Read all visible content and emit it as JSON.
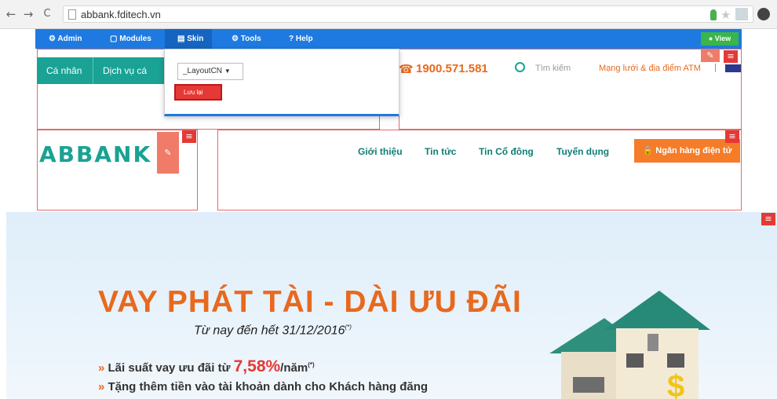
{
  "browser": {
    "back": "←",
    "forward": "→",
    "reload": "C",
    "url": "abbank.fditech.vn"
  },
  "admin_bar": {
    "items": [
      {
        "icon": "⚙",
        "label": "Admin"
      },
      {
        "icon": "▢",
        "label": "Modules"
      },
      {
        "icon": "▤",
        "label": "Skin"
      },
      {
        "icon": "⚙",
        "label": "Tools"
      },
      {
        "icon": "?",
        "label": "Help"
      }
    ],
    "view_label": "View"
  },
  "skin_popup": {
    "selected_layout": "_LayoutCN",
    "save_label": "Lưu lại"
  },
  "header": {
    "nav": [
      "Cá nhân",
      "Dịch vụ cá nhâ"
    ],
    "hotline": "1900.571.581",
    "search_placeholder": "Tìm kiếm",
    "atm_link": "Mạng lưới & địa điểm ATM",
    "separator": "|"
  },
  "main_nav": {
    "logo": "ABBANK",
    "items": [
      "Giới thiệu",
      "Tin tức",
      "Tin Cổ đông",
      "Tuyển dụng"
    ],
    "ebank_label": "Ngân hàng điện tử"
  },
  "banner": {
    "title": "VAY PHÁT TÀI - DÀI ƯU ĐÃI",
    "date_line": "Từ nay đến hết 31/12/2016",
    "footnote": "(*)",
    "bullet1_prefix": "Lãi suất vay ưu đãi từ",
    "bullet1_rate": "7,58%",
    "bullet1_suffix": "/năm",
    "bullet2": "Tặng thêm tiền vào tài khoản dành cho Khách hàng đăng"
  },
  "colors": {
    "admin_blue": "#1e7ae0",
    "teal": "#1aa294",
    "orange": "#e8691e",
    "red": "#e53935"
  }
}
